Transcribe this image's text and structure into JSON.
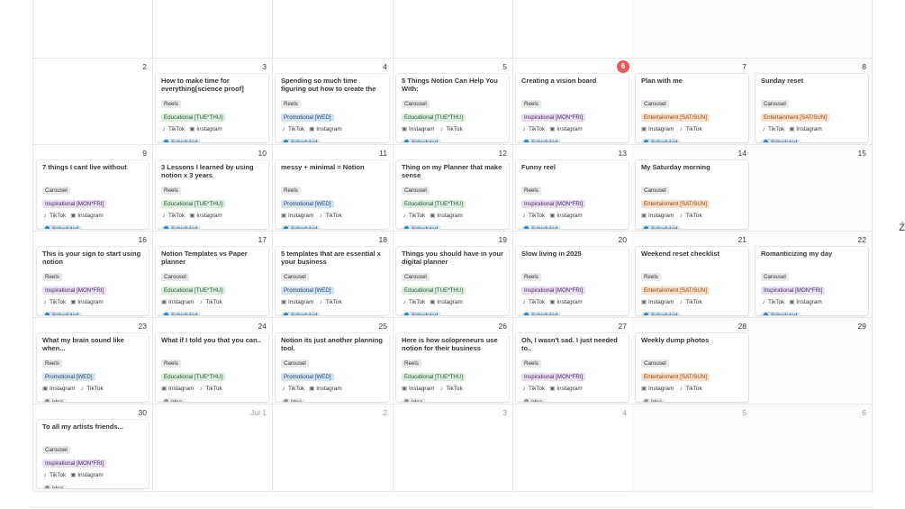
{
  "colors": {
    "tags": {
      "Educational [TUE*THU]": {
        "bg": "#dbeddb",
        "fg": "#2b593f"
      },
      "Promotional [WED]": {
        "bg": "#d3e5ef",
        "fg": "#28456c"
      },
      "Inspirational [MON*FRI]": {
        "bg": "#e8deee",
        "fg": "#492f64"
      },
      "Entertainment [SAT/SUN]": {
        "bg": "#fadec9",
        "fg": "#854c1d"
      }
    },
    "status": {
      "Scheduled": {
        "bg": "#d3e5ef",
        "fg": "#28456c",
        "dot": "#2f80c1"
      },
      "Idea": {
        "bg": "#e9e9e7",
        "fg": "#37352f",
        "dot": "#91918e"
      }
    },
    "today_badge": "#eb5757"
  },
  "icons": {
    "TikTok": "tiktok-icon",
    "Instagram": "instagram-icon"
  },
  "calendar": {
    "weeks": [
      [
        {
          "day": ""
        },
        {
          "day": ""
        },
        {
          "day": ""
        },
        {
          "day": ""
        },
        {
          "day": ""
        },
        {
          "day": ""
        },
        {
          "day": ""
        }
      ],
      [
        {
          "day": "2"
        },
        {
          "day": "3",
          "event": {
            "title": "How to make time for everything[science proof]",
            "format": "Reels",
            "tag": "Educational [TUE*THU]",
            "platforms": [
              "TikTok",
              "Instagram"
            ],
            "status": "Scheduled"
          }
        },
        {
          "day": "4",
          "event": {
            "title": "Spending so much time figuring out how to create the template",
            "format": "Reels",
            "tag": "Promotional [WED]",
            "platforms": [
              "TikTok",
              "Instagram"
            ],
            "status": "Scheduled"
          }
        },
        {
          "day": "5",
          "event": {
            "title": "5 Things Notion Can Help You With:",
            "format": "Carousel",
            "tag": "Educational [TUE*THU]",
            "platforms": [
              "Instagram",
              "TikTok"
            ],
            "status": "Scheduled"
          }
        },
        {
          "day": "6",
          "today": true,
          "event": {
            "title": "Creating a vision board",
            "format": "Reels",
            "tag": "Inspirational [MON*FRI]",
            "platforms": [
              "TikTok",
              "Instagram"
            ],
            "status": "Scheduled"
          }
        },
        {
          "day": "7",
          "event": {
            "title": "Plan with me",
            "format": "Carousel",
            "tag": "Entertainment [SAT/SUN]",
            "platforms": [
              "Instagram",
              "TikTok"
            ],
            "status": "Scheduled"
          }
        },
        {
          "day": "8",
          "event": {
            "title": "Sunday reset",
            "format": "Carousel",
            "tag": "Entertainment [SAT/SUN]",
            "platforms": [
              "TikTok",
              "Instagram"
            ],
            "status": "Scheduled"
          }
        }
      ],
      [
        {
          "day": "9",
          "event": {
            "title": "7 things I cant live without",
            "format": "Carousel",
            "tag": "Inspirational [MON*FRI]",
            "platforms": [
              "TikTok",
              "Instagram"
            ],
            "status": "Scheduled"
          }
        },
        {
          "day": "10",
          "event": {
            "title": "3 Lessons I learned by using notion x 3 years",
            "format": "Reels",
            "tag": "Educational [TUE*THU]",
            "platforms": [
              "TikTok",
              "Instagram"
            ],
            "status": "Scheduled"
          }
        },
        {
          "day": "11",
          "event": {
            "title": "messy + minimal = Notion",
            "format": "Reels",
            "tag": "Promotional [WED]",
            "platforms": [
              "Instagram",
              "TikTok"
            ],
            "status": "Scheduled"
          }
        },
        {
          "day": "12",
          "event": {
            "title": "Thing on my Planner that make sense",
            "format": "Carousel",
            "tag": "Educational [TUE*THU]",
            "platforms": [
              "TikTok",
              "Instagram"
            ],
            "status": "Scheduled"
          }
        },
        {
          "day": "13",
          "event": {
            "title": "Funny reel",
            "format": "Reels",
            "tag": "Inspirational [MON*FRI]",
            "platforms": [
              "TikTok",
              "Instagram"
            ],
            "status": "Scheduled"
          }
        },
        {
          "day": "14",
          "event": {
            "title": "My Saturday morning",
            "format": "Carousel",
            "tag": "Entertainment [SAT/SUN]",
            "platforms": [
              "Instagram",
              "TikTok"
            ],
            "status": "Scheduled"
          }
        },
        {
          "day": "15"
        }
      ],
      [
        {
          "day": "16",
          "event": {
            "title": "This is your sign to start using notion",
            "format": "Reels",
            "tag": "Inspirational [MON*FRI]",
            "platforms": [
              "TikTok",
              "Instagram"
            ],
            "status": "Scheduled"
          }
        },
        {
          "day": "17",
          "event": {
            "title": "Notion Templates vs Paper planner",
            "format": "Carousel",
            "tag": "Educational [TUE*THU]",
            "platforms": [
              "Instagram",
              "TikTok"
            ],
            "status": "Scheduled"
          }
        },
        {
          "day": "18",
          "event": {
            "title": "5 templates that are essential x your business",
            "format": "Carousel",
            "tag": "Promotional [WED]",
            "platforms": [
              "Instagram",
              "TikTok"
            ],
            "status": "Scheduled"
          }
        },
        {
          "day": "19",
          "event": {
            "title": "Things you should have in your digital planner",
            "format": "Carousel",
            "tag": "Educational [TUE*THU]",
            "platforms": [
              "TikTok",
              "Instagram"
            ],
            "status": "Scheduled"
          }
        },
        {
          "day": "20",
          "event": {
            "title": "Slow living in 2025",
            "format": "Reels",
            "tag": "Inspirational [MON*FRI]",
            "platforms": [
              "TikTok",
              "Instagram"
            ],
            "status": "Scheduled"
          }
        },
        {
          "day": "21",
          "event": {
            "title": "Weekend reset checklist",
            "format": "Reels",
            "tag": "Entertainment [SAT/SUN]",
            "platforms": [
              "Instagram",
              "TikTok"
            ],
            "status": "Scheduled"
          }
        },
        {
          "day": "22",
          "event": {
            "title": "Romanticizing my day",
            "format": "Carousel",
            "tag": "Inspirational [MON*FRI]",
            "platforms": [
              "TikTok",
              "Instagram"
            ],
            "status": "Scheduled"
          }
        }
      ],
      [
        {
          "day": "23",
          "event": {
            "title": "What my brain sound like when...",
            "format": "Reels",
            "tag": "Promotional [WED]",
            "platforms": [
              "Instagram",
              "TikTok"
            ],
            "status": "Idea"
          }
        },
        {
          "day": "24",
          "event": {
            "title": "What if I told you that you can..",
            "format": "Reels",
            "tag": "Educational [TUE*THU]",
            "platforms": [
              "Instagram",
              "TikTok"
            ],
            "status": "Idea"
          }
        },
        {
          "day": "25",
          "event": {
            "title": "Notion its just another planning tool.",
            "format": "Carousel",
            "tag": "Promotional [WED]",
            "platforms": [
              "TikTok",
              "Instagram"
            ],
            "status": "Idea"
          }
        },
        {
          "day": "26",
          "event": {
            "title": "Here is how solopreneurs use notion for their business",
            "format": "Reels",
            "tag": "Educational [TUE*THU]",
            "platforms": [
              "Instagram",
              "TikTok"
            ],
            "status": "Idea"
          }
        },
        {
          "day": "27",
          "event": {
            "title": "Oh, I wasn't sad. I just needed to..",
            "format": "Reels",
            "tag": "Inspirational [MON*FRI]",
            "platforms": [
              "TikTok",
              "Instagram"
            ],
            "status": "Idea"
          }
        },
        {
          "day": "28",
          "event": {
            "title": "Weekly dump photos",
            "format": "Carousel",
            "tag": "Entertainment [SAT/SUN]",
            "platforms": [
              "Instagram",
              "TikTok"
            ],
            "status": "Idea"
          }
        },
        {
          "day": "29"
        }
      ],
      [
        {
          "day": "30",
          "event": {
            "title": "To all my artists friends...",
            "format": "Carousel",
            "tag": "Inspirational [MON*FRI]",
            "platforms": [
              "TikTok",
              "Instagram"
            ],
            "status": "Idea"
          }
        },
        {
          "day": "Jul 1",
          "muted": true
        },
        {
          "day": "2",
          "muted": true
        },
        {
          "day": "3",
          "muted": true
        },
        {
          "day": "4",
          "muted": true
        },
        {
          "day": "5",
          "muted": true
        },
        {
          "day": "6",
          "muted": true
        }
      ]
    ]
  },
  "edge_glyph": "Ź"
}
